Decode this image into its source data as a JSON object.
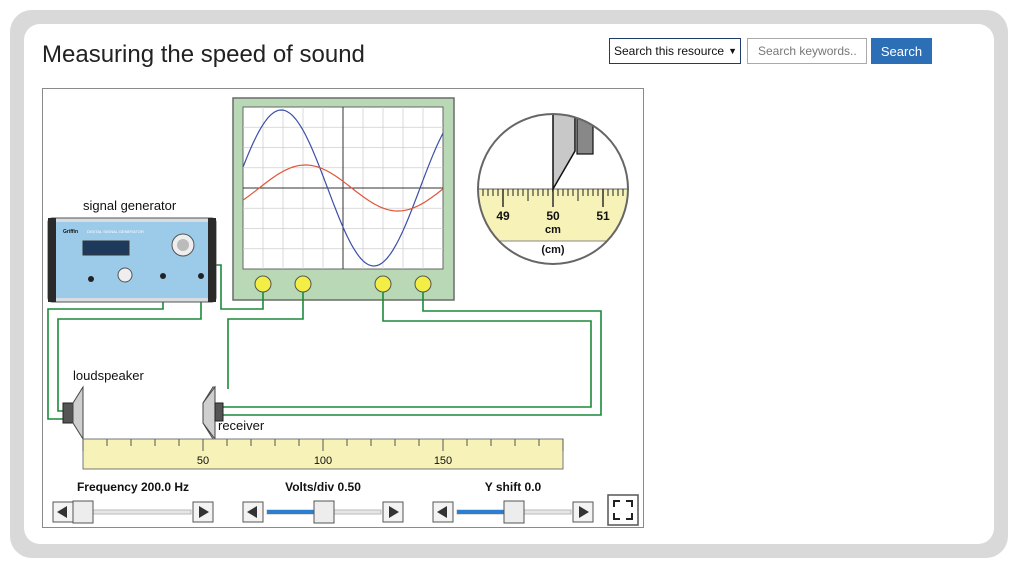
{
  "header": {
    "title": "Measuring the speed of sound",
    "search_scope": "Search this resource",
    "search_placeholder": "Search keywords..",
    "search_button": "Search"
  },
  "sim": {
    "signal_generator_label": "signal generator",
    "generator_brand": "Griffin",
    "generator_title": "DIGITAL SIGNAL GENERATOR",
    "loudspeaker_label": "loudspeaker",
    "receiver_label": "receiver",
    "ruler_ticks": [
      "50",
      "100",
      "150"
    ],
    "zoom_ticks": [
      "49",
      "50",
      "51"
    ],
    "zoom_unit": "cm",
    "zoom_unit_paren": "(cm)",
    "frequency_label": "Frequency 200.0 Hz",
    "volts_label": "Volts/div 0.50",
    "yshift_label": "Y shift 0.0",
    "frequency_slider_fraction": 0.0,
    "volts_slider_fraction": 0.5,
    "yshift_slider_fraction": 0.5
  },
  "colors": {
    "wire": "#1a8a3a",
    "trace_transmit": "#3b4fa8",
    "trace_receive": "#e0553a",
    "ruler": "#f6f2b8",
    "scope_body": "#b9d8b6",
    "slider_fill": "#2c7fd0",
    "search_button": "#2c6fb7"
  },
  "icons": {
    "fullscreen": "fullscreen-icon",
    "left": "arrow-left-icon",
    "right": "arrow-right-icon"
  }
}
